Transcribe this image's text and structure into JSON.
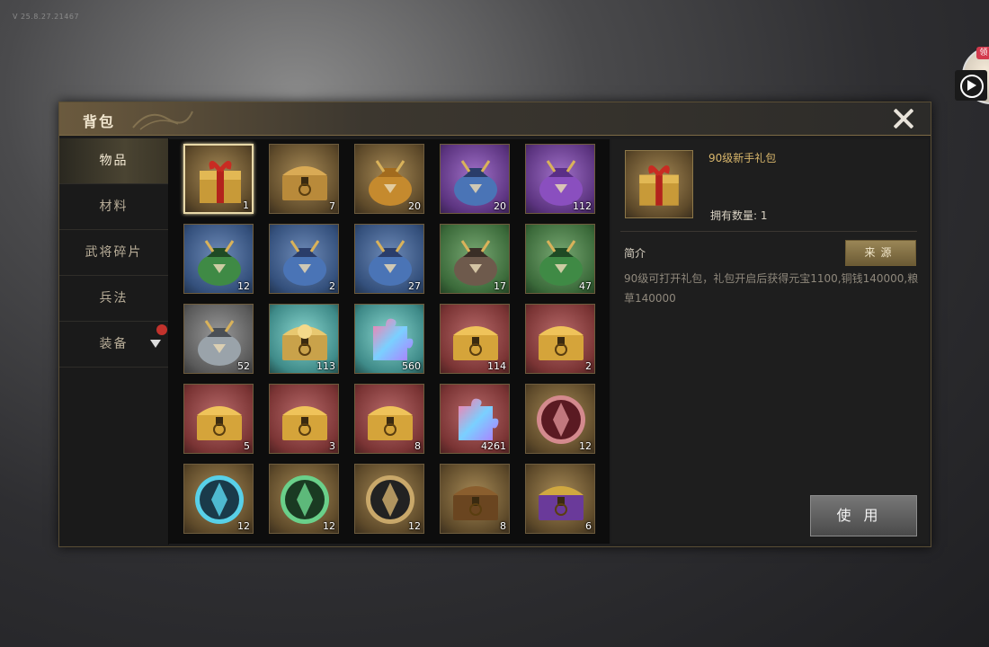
{
  "version": "V 25.8.27.21467",
  "float_icon": {
    "badge": "领"
  },
  "panel": {
    "title": "背包"
  },
  "sidebar": {
    "tabs": [
      {
        "label": "物品",
        "active": true
      },
      {
        "label": "材料",
        "active": false
      },
      {
        "label": "武将碎片",
        "active": false
      },
      {
        "label": "兵法",
        "active": false
      },
      {
        "label": "装备",
        "active": false
      }
    ]
  },
  "grid": {
    "items": [
      {
        "icon": "gift-box-icon",
        "qty": "1",
        "bg": "gold",
        "selected": true
      },
      {
        "icon": "treasure-chest-icon",
        "qty": "7",
        "bg": "gold"
      },
      {
        "icon": "gold-pouch-icon",
        "qty": "20",
        "bg": "gold"
      },
      {
        "icon": "blue-pouch-icon",
        "qty": "20",
        "bg": "purple"
      },
      {
        "icon": "purple-pouch-icon",
        "qty": "112",
        "bg": "purple"
      },
      {
        "icon": "green-pouch-icon",
        "qty": "12",
        "bg": "blue"
      },
      {
        "icon": "blue-pouch-icon",
        "qty": "2",
        "bg": "blue"
      },
      {
        "icon": "blue-pouch-icon",
        "qty": "27",
        "bg": "blue"
      },
      {
        "icon": "brown-pouch-icon",
        "qty": "17",
        "bg": "green"
      },
      {
        "icon": "green-pouch-icon",
        "qty": "47",
        "bg": "green"
      },
      {
        "icon": "grey-pouch-icon",
        "qty": "52",
        "bg": "grey"
      },
      {
        "icon": "open-chest-icon",
        "qty": "113",
        "bg": "cyan"
      },
      {
        "icon": "puzzle-piece-icon",
        "qty": "560",
        "bg": "cyan"
      },
      {
        "icon": "gold-chest-icon",
        "qty": "114",
        "bg": "red"
      },
      {
        "icon": "gold-chest-icon",
        "qty": "2",
        "bg": "red"
      },
      {
        "icon": "gold-chest-icon",
        "qty": "5",
        "bg": "red"
      },
      {
        "icon": "gold-chest-icon",
        "qty": "3",
        "bg": "red"
      },
      {
        "icon": "gold-chest-icon",
        "qty": "8",
        "bg": "red"
      },
      {
        "icon": "puzzle-piece-icon",
        "qty": "4261",
        "bg": "red"
      },
      {
        "icon": "red-orb-icon",
        "qty": "12",
        "bg": "gold"
      },
      {
        "icon": "cyan-orb-icon",
        "qty": "12",
        "bg": "gold"
      },
      {
        "icon": "green-orb-icon",
        "qty": "12",
        "bg": "gold"
      },
      {
        "icon": "dark-orb-icon",
        "qty": "12",
        "bg": "gold"
      },
      {
        "icon": "wooden-chest-icon",
        "qty": "8",
        "bg": "gold"
      },
      {
        "icon": "purple-chest-icon",
        "qty": "6",
        "bg": "gold"
      }
    ]
  },
  "detail": {
    "icon": "gift-box-icon",
    "name": "90级新手礼包",
    "owned": "拥有数量: 1",
    "intro_label": "简介",
    "source_button": "来源",
    "description": "90级可打开礼包，礼包开启后获得元宝1100,铜钱140000,粮草140000",
    "use_button": "使用"
  }
}
